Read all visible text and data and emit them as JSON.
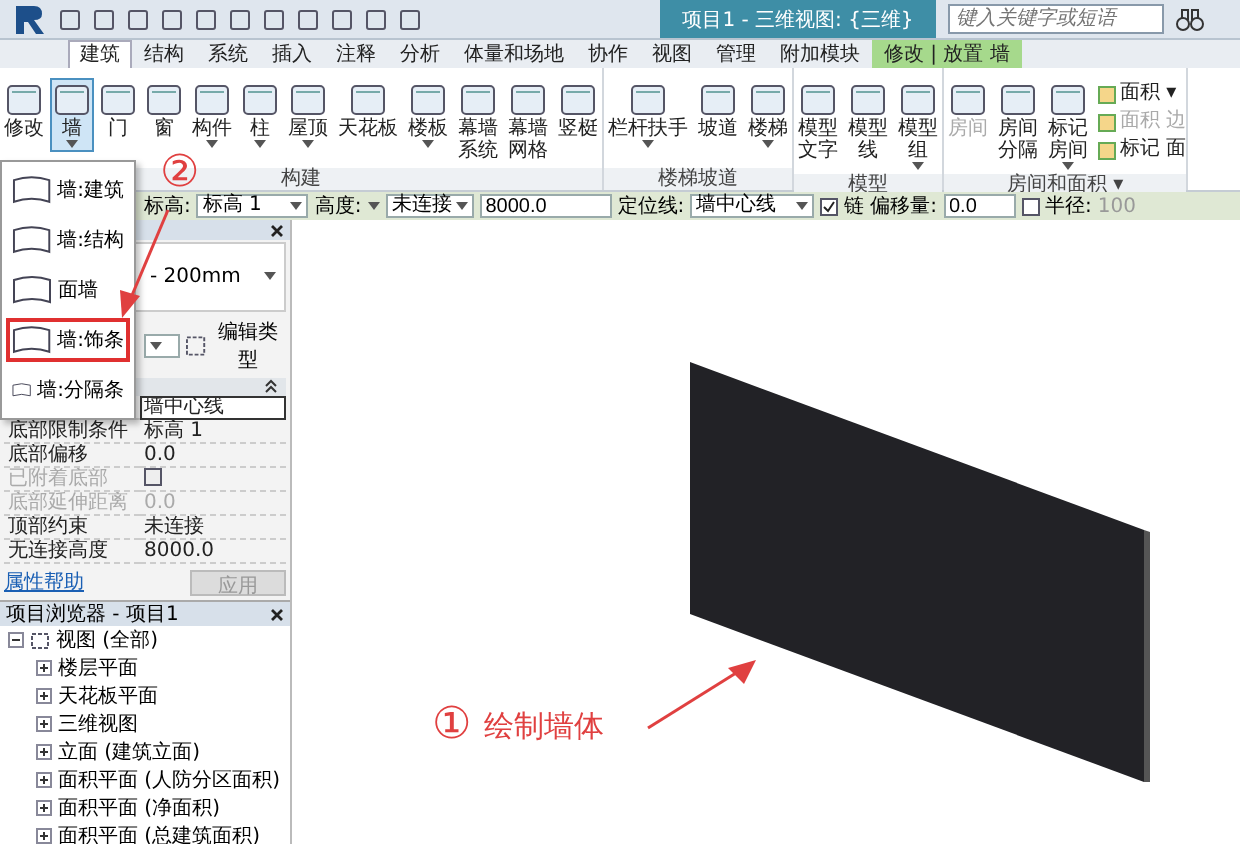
{
  "title_bar": {
    "title": "项目1 - 三维视图: {三维}",
    "search_placeholder": "键入关键字或短语"
  },
  "ribbon_tabs": [
    {
      "label": "建筑",
      "selected": true,
      "kind": "normal"
    },
    {
      "label": "结构",
      "selected": false,
      "kind": "normal"
    },
    {
      "label": "系统",
      "selected": false,
      "kind": "normal"
    },
    {
      "label": "插入",
      "selected": false,
      "kind": "normal"
    },
    {
      "label": "注释",
      "selected": false,
      "kind": "normal"
    },
    {
      "label": "分析",
      "selected": false,
      "kind": "normal"
    },
    {
      "label": "体量和场地",
      "selected": false,
      "kind": "normal"
    },
    {
      "label": "协作",
      "selected": false,
      "kind": "normal"
    },
    {
      "label": "视图",
      "selected": false,
      "kind": "normal"
    },
    {
      "label": "管理",
      "selected": false,
      "kind": "normal"
    },
    {
      "label": "附加模块",
      "selected": false,
      "kind": "normal"
    },
    {
      "label": "修改 | 放置 墙",
      "selected": false,
      "kind": "contextual"
    }
  ],
  "ribbon_panels": [
    {
      "label": "构建",
      "tools": [
        {
          "lines": [
            "修改"
          ],
          "selected": false,
          "has_menu": false
        },
        {
          "lines": [
            "墙"
          ],
          "selected": true,
          "has_menu": true
        },
        {
          "lines": [
            "门"
          ],
          "selected": false,
          "has_menu": false
        },
        {
          "lines": [
            "窗"
          ],
          "selected": false,
          "has_menu": false
        },
        {
          "lines": [
            "构件"
          ],
          "selected": false,
          "has_menu": true
        },
        {
          "lines": [
            "柱"
          ],
          "selected": false,
          "has_menu": true
        },
        {
          "lines": [
            "屋顶"
          ],
          "selected": false,
          "has_menu": true
        },
        {
          "lines": [
            "天花板"
          ],
          "selected": false,
          "has_menu": false
        },
        {
          "lines": [
            "楼板"
          ],
          "selected": false,
          "has_menu": true
        },
        {
          "lines": [
            "幕墙",
            "系统"
          ],
          "selected": false,
          "has_menu": false
        },
        {
          "lines": [
            "幕墙",
            "网格"
          ],
          "selected": false,
          "has_menu": false
        },
        {
          "lines": [
            "竖梃"
          ],
          "selected": false,
          "has_menu": false
        }
      ]
    },
    {
      "label": "楼梯坡道",
      "tools": [
        {
          "lines": [
            "栏杆扶手"
          ],
          "selected": false,
          "has_menu": true
        },
        {
          "lines": [
            "坡道"
          ],
          "selected": false,
          "has_menu": false
        },
        {
          "lines": [
            "楼梯"
          ],
          "selected": false,
          "has_menu": true
        }
      ]
    },
    {
      "label": "模型",
      "tools": [
        {
          "lines": [
            "模型",
            "文字"
          ],
          "selected": false,
          "has_menu": false
        },
        {
          "lines": [
            "模型",
            "线"
          ],
          "selected": false,
          "has_menu": false
        },
        {
          "lines": [
            "模型",
            "组"
          ],
          "selected": false,
          "has_menu": true
        }
      ]
    },
    {
      "label": "房间和面积 ▾",
      "tools": [
        {
          "lines": [
            "房间"
          ],
          "selected": false,
          "has_menu": false,
          "disabled": true
        },
        {
          "lines": [
            "房间",
            "分隔"
          ],
          "selected": false,
          "has_menu": false,
          "disabled": false
        },
        {
          "lines": [
            "标记",
            "房间"
          ],
          "selected": false,
          "has_menu": true,
          "disabled": false
        }
      ],
      "small_tools": [
        {
          "label": "面积 ▾",
          "disabled": false
        },
        {
          "label": "面积 边",
          "disabled": true
        },
        {
          "label": "标记 面",
          "disabled": false
        }
      ]
    }
  ],
  "options_bar": {
    "level_label": "标高:",
    "level_value": "标高 1",
    "height_label": "高度:",
    "height_value": "未连接",
    "height_number": "8000.0",
    "location_label": "定位线:",
    "location_value": "墙中心线",
    "chain_label": "链",
    "chain_checked": true,
    "offset_label": "偏移量:",
    "offset_value": "0.0",
    "radius_label": "半径:",
    "radius_checked": false,
    "radius_value": "100"
  },
  "wall_menu": [
    {
      "label": "墙:建筑",
      "highlighted": false
    },
    {
      "label": "墙:结构",
      "highlighted": false
    },
    {
      "label": "面墙",
      "highlighted": false
    },
    {
      "label": "墙:饰条",
      "highlighted": true
    },
    {
      "label": "墙:分隔条",
      "highlighted": false
    }
  ],
  "properties": {
    "type_line": "- 200mm",
    "edit_type": "编辑类型",
    "rows": [
      {
        "value": "墙中心线",
        "editing": true,
        "disabled": false,
        "kind": "text"
      },
      {
        "name": "底部限制条件",
        "value": "标高 1",
        "disabled": false,
        "kind": "text"
      },
      {
        "name": "底部偏移",
        "value": "0.0",
        "disabled": false,
        "kind": "text"
      },
      {
        "name": "已附着底部",
        "checked": false,
        "disabled": true,
        "kind": "checkbox"
      },
      {
        "name": "底部延伸距离",
        "value": "0.0",
        "disabled": true,
        "kind": "text"
      },
      {
        "name": "顶部约束",
        "value": "未连接",
        "disabled": false,
        "kind": "text"
      },
      {
        "name": "无连接高度",
        "value": "8000.0",
        "disabled": false,
        "kind": "text"
      }
    ],
    "help_link": "属性帮助",
    "apply_button": "应用",
    "apply_disabled": true
  },
  "project_browser": {
    "title": "项目浏览器 - 项目1",
    "tree": [
      {
        "label": "视图 (全部)",
        "expanded": true,
        "children": [
          {
            "label": "楼层平面",
            "expanded": false
          },
          {
            "label": "天花板平面",
            "expanded": false
          },
          {
            "label": "三维视图",
            "expanded": false
          },
          {
            "label": "立面 (建筑立面)",
            "expanded": false
          },
          {
            "label": "面积平面 (人防分区面积)",
            "expanded": false
          },
          {
            "label": "面积平面 (净面积)",
            "expanded": false
          },
          {
            "label": "面积平面 (总建筑面积)",
            "expanded": false
          }
        ]
      }
    ]
  },
  "annotations": [
    {
      "number": "①",
      "text": "绘制墙体"
    },
    {
      "number": "②"
    }
  ]
}
